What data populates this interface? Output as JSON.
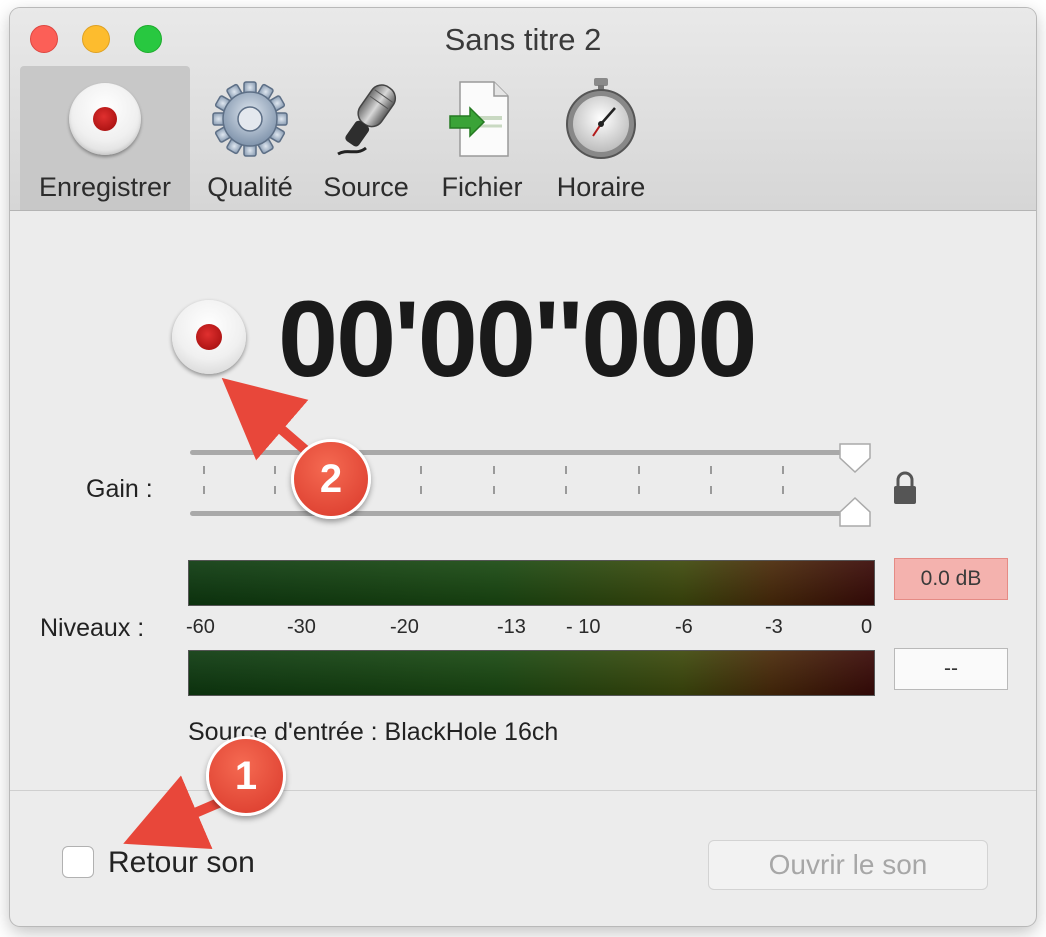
{
  "window": {
    "title": "Sans titre 2"
  },
  "tabs": [
    {
      "label": "Enregistrer",
      "icon": "record-icon",
      "active": true
    },
    {
      "label": "Qualité",
      "icon": "gear-icon"
    },
    {
      "label": "Source",
      "icon": "microphone-icon"
    },
    {
      "label": "Fichier",
      "icon": "file-icon"
    },
    {
      "label": "Horaire",
      "icon": "stopwatch-icon"
    }
  ],
  "recorder": {
    "time": "00'00''000"
  },
  "gain": {
    "label": "Gain :",
    "level": 1.0
  },
  "levels": {
    "label": "Niveaux :",
    "scale": [
      "-60",
      "-30",
      "-20",
      "-13",
      "- 10",
      "-6",
      "-3",
      "0"
    ],
    "peak_top": "0.0 dB",
    "peak_bottom": "--"
  },
  "source": {
    "text": "Source d'entrée : BlackHole 16ch"
  },
  "footer": {
    "monitor_label": "Retour son",
    "monitor_checked": false,
    "open_label": "Ouvrir le son"
  },
  "annotations": [
    "1",
    "2"
  ],
  "colors": {
    "annotation": "#e8473a",
    "record": "#c41414",
    "peak_warning": "#f4b2ae"
  }
}
